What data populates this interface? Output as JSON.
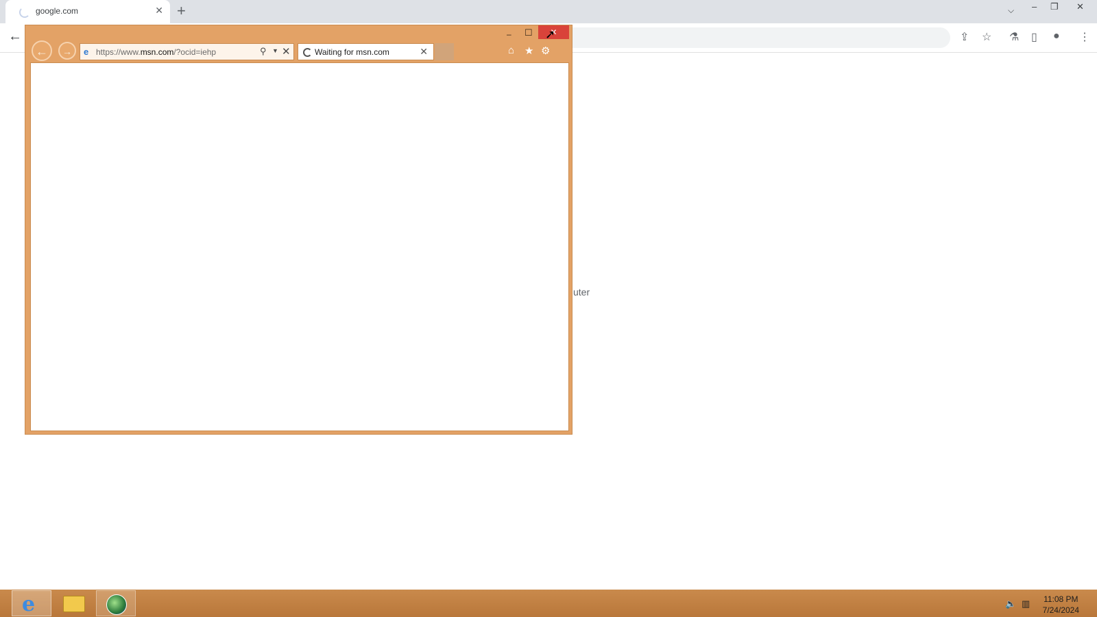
{
  "chrome": {
    "tab_title": "google.com",
    "tab_close": "✕",
    "new_tab": "+",
    "win_min": "–",
    "win_restore": "❐",
    "win_close": "✕",
    "back": "←",
    "background_text": "uter"
  },
  "ie": {
    "min": "–",
    "max": "☐",
    "close": "✕",
    "back": "←",
    "forward": "→",
    "url_prefix": "https://www.",
    "url_host": "msn.com",
    "url_suffix": "/?ocid=iehp",
    "tab_label": "Waiting for msn.com",
    "tab_close": "✕",
    "home": "⌂",
    "favorites": "★",
    "settings": "⚙"
  },
  "taskbar": {
    "time": "11:08 PM",
    "date": "7/24/2024"
  }
}
